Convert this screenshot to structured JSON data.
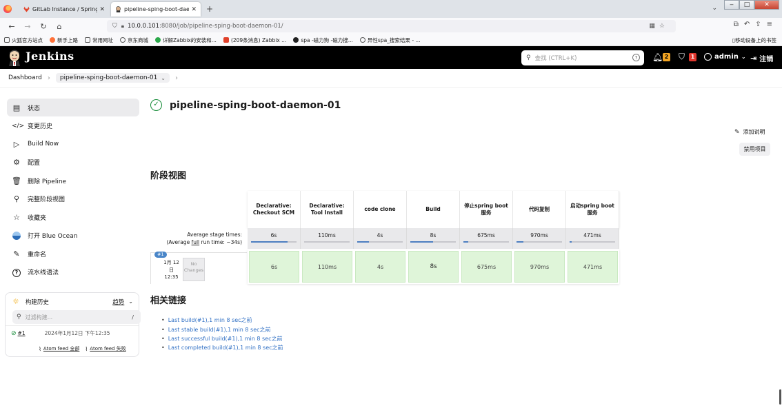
{
  "browser": {
    "tabs": [
      {
        "title": "GitLab Instance / Spring Boo",
        "active": false
      },
      {
        "title": "pipeline-sping-boot-daemo",
        "active": true
      }
    ],
    "url_host": "10.0.0.101",
    "url_path": ":8080/job/pipeline-sping-boot-daemon-01/",
    "bookmarks": [
      "火狐官方站点",
      "新手上路",
      "常用网址",
      "京东商城",
      "详解Zabbix的安装和...",
      "(209条消息) Zabbix ...",
      "spa -磁力狗 -磁力搜...",
      "异性spa_搜索结果 - ..."
    ],
    "mobile_bookmarks": "移动设备上的书签"
  },
  "header": {
    "title": "Jenkins",
    "search_placeholder": "查找 (CTRL+K)",
    "notifications": "2",
    "security": "1",
    "user": "admin",
    "logout": "注销"
  },
  "breadcrumb": {
    "root": "Dashboard",
    "current": "pipeline-sping-boot-daemon-01"
  },
  "sidebar": {
    "items": [
      {
        "label": "状态",
        "icon": "document-icon"
      },
      {
        "label": "变更历史",
        "icon": "code-icon"
      },
      {
        "label": "Build Now",
        "icon": "play-icon"
      },
      {
        "label": "配置",
        "icon": "gear-icon"
      },
      {
        "label": "删除 Pipeline",
        "icon": "trash-icon"
      },
      {
        "label": "完整阶段视图",
        "icon": "search-icon"
      },
      {
        "label": "收藏夹",
        "icon": "star-icon"
      },
      {
        "label": "打开 Blue Ocean",
        "icon": "blue-ocean-icon"
      },
      {
        "label": "重命名",
        "icon": "pencil-icon"
      },
      {
        "label": "流水线语法",
        "icon": "help-icon"
      }
    ]
  },
  "history": {
    "title": "构建历史",
    "trend": "趋势",
    "filter_placeholder": "过滤构建...",
    "filter_shortcut": "/",
    "builds": [
      {
        "number": "#1",
        "date": "2024年1月12日 下午12:35"
      }
    ],
    "feed_all": "Atom feed 全部",
    "feed_failed": "Atom feed 失败"
  },
  "main": {
    "title": "pipeline-sping-boot-daemon-01",
    "add_description": "添加说明",
    "disable_project": "禁用项目",
    "stage_view_title": "阶段视图",
    "related_links_title": "相关链接"
  },
  "stage_view": {
    "stages": [
      "Declarative: Checkout SCM",
      "Declarative: Tool Install",
      "code clone",
      "Build",
      "停止spring boot服务",
      "代码复制",
      "启动spring boot服务"
    ],
    "avg_times": [
      "6s",
      "110ms",
      "4s",
      "8s",
      "675ms",
      "970ms",
      "471ms"
    ],
    "avg_fill": [
      0.8,
      0.0,
      0.25,
      0.5,
      0.1,
      0.15,
      0.05
    ],
    "avg_label_line1": "Average stage times:",
    "avg_label_prefix": "(Average ",
    "avg_label_link": "full",
    "avg_label_suffix": " run time: ~34s)",
    "build": {
      "badge": "#1",
      "date_line1": "1月 12",
      "date_line2": "日",
      "date_line3": "12:35",
      "no_changes_1": "No",
      "no_changes_2": "Changes",
      "times": [
        "6s",
        "110ms",
        "4s",
        "8s",
        "675ms",
        "970ms",
        "471ms"
      ]
    }
  },
  "related_links": [
    "Last build(#1),1 min 8 sec之前",
    "Last stable build(#1),1 min 8 sec之前",
    "Last successful build(#1),1 min 8 sec之前",
    "Last completed build(#1),1 min 8 sec之前"
  ]
}
